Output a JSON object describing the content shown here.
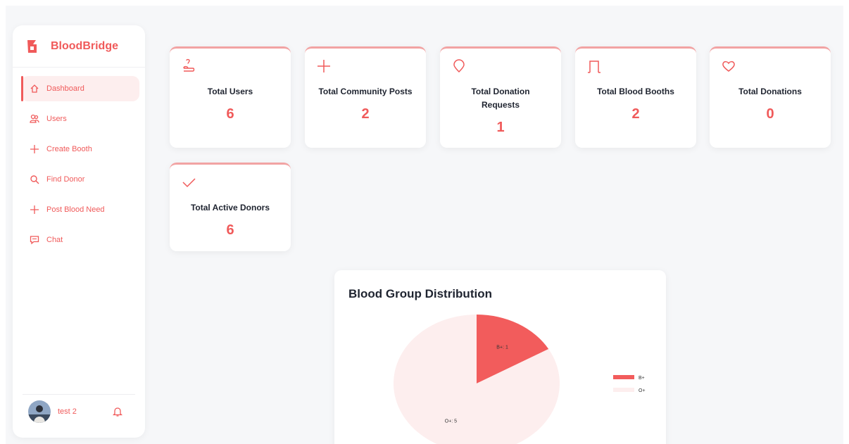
{
  "app": {
    "name": "BloodBridge",
    "accent_color": "#f05a5a",
    "light_accent": "#fdeeee"
  },
  "sidebar": {
    "items": [
      {
        "label": "Dashboard",
        "icon": "home-icon",
        "active": true
      },
      {
        "label": "Users",
        "icon": "users-icon",
        "active": false
      },
      {
        "label": "Create Booth",
        "icon": "plus-icon",
        "active": false
      },
      {
        "label": "Find Donor",
        "icon": "search-icon",
        "active": false
      },
      {
        "label": "Post Blood Need",
        "icon": "plus-icon",
        "active": false
      },
      {
        "label": "Chat",
        "icon": "chat-icon",
        "active": false
      }
    ],
    "user": {
      "name": "test 2",
      "avatar": "user-avatar",
      "notification_icon": "bell-icon"
    }
  },
  "stats": [
    {
      "title": "Total Users",
      "value": "6",
      "icon": "user-hand-icon"
    },
    {
      "title": "Total Community Posts",
      "value": "2",
      "icon": "plus-icon"
    },
    {
      "title": "Total Donation Requests",
      "value": "1",
      "icon": "drop-icon"
    },
    {
      "title": "Total Blood Booths",
      "value": "2",
      "icon": "booth-icon"
    },
    {
      "title": "Total Donations",
      "value": "0",
      "icon": "heart-icon"
    },
    {
      "title": "Total Active Donors",
      "value": "6",
      "icon": "check-icon"
    }
  ],
  "chart_data": {
    "type": "pie",
    "title": "Blood Group Distribution",
    "categories": [
      "B+",
      "O+"
    ],
    "values": [
      1,
      5
    ],
    "slice_labels": [
      "B+: 1",
      "O+: 5"
    ],
    "colors": [
      "#f25c5c",
      "#fdeeee"
    ],
    "legend": "right"
  }
}
